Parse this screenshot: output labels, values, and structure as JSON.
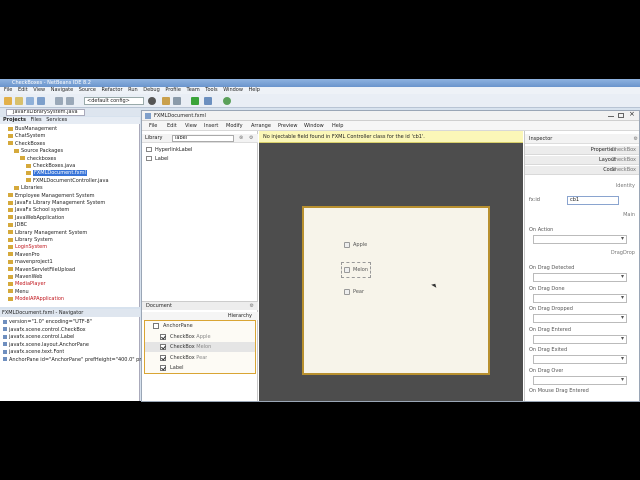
{
  "netbeans": {
    "title": "CheckBoxes - NetBeans IDE 8.2",
    "menu": [
      "File",
      "Edit",
      "View",
      "Navigate",
      "Source",
      "Refactor",
      "Run",
      "Debug",
      "Profile",
      "Team",
      "Tools",
      "Window",
      "Help"
    ],
    "config": "<default config>",
    "file_tab": "JavaFxLibrarySystem.java",
    "project_tabs": [
      "Projects",
      "Files",
      "Services"
    ],
    "projects": [
      {
        "label": "BusManagement",
        "indent": 1
      },
      {
        "label": "ChatSystem",
        "indent": 1
      },
      {
        "label": "CheckBoxes",
        "indent": 1
      },
      {
        "label": "Source Packages",
        "indent": 2
      },
      {
        "label": "checkboxes",
        "indent": 3
      },
      {
        "label": "CheckBoxes.java",
        "indent": 4
      },
      {
        "label": "FXMLDocument.fxml",
        "indent": 4,
        "selected": true
      },
      {
        "label": "FXMLDocumentController.java",
        "indent": 4
      },
      {
        "label": "Libraries",
        "indent": 2
      },
      {
        "label": "Employee Management System",
        "indent": 1
      },
      {
        "label": "JavaFx Library Management System",
        "indent": 1
      },
      {
        "label": "JavaFx School system",
        "indent": 1
      },
      {
        "label": "JavaWebApplication",
        "indent": 1
      },
      {
        "label": "JDBC",
        "indent": 1
      },
      {
        "label": "Library Management System",
        "indent": 1
      },
      {
        "label": "Library System",
        "indent": 1
      },
      {
        "label": "LoginSystem",
        "indent": 1,
        "red": true
      },
      {
        "label": "MavenPro",
        "indent": 1
      },
      {
        "label": "mavenproject1",
        "indent": 1
      },
      {
        "label": "MavenServletFileUpload",
        "indent": 1
      },
      {
        "label": "MavenWeb",
        "indent": 1
      },
      {
        "label": "MediaPlayer",
        "indent": 1,
        "red": true
      },
      {
        "label": "Menu",
        "indent": 1
      },
      {
        "label": "ModelAPApplication",
        "indent": 1,
        "red": true
      }
    ],
    "navigator_title": "FXMLDocument.fxml - Navigator",
    "navigator": [
      "version=\"1.0\" encoding=\"UTF-8\"",
      "javafx.scene.control.CheckBox",
      "javafx.scene.control.Label",
      "javafx.scene.layout.AnchorPane",
      "javafx.scene.text.Font",
      "AnchorPane id=\"AnchorPane\" prefHeight=\"400.0\" prefWidth"
    ]
  },
  "scenebuilder": {
    "title": "FXMLDocument.fxml",
    "menu": [
      "File",
      "Edit",
      "View",
      "Insert",
      "Modify",
      "Arrange",
      "Preview",
      "Window",
      "Help"
    ],
    "library_label": "Library",
    "library_search": "label",
    "library_items": [
      "HyperlinkLabel",
      "Label"
    ],
    "document_label": "Document",
    "hierarchy_label": "Hierarchy",
    "hierarchy": [
      {
        "type": "AnchorPane",
        "value": "",
        "checked": false,
        "root": true
      },
      {
        "type": "CheckBox",
        "value": "Apple",
        "checked": true
      },
      {
        "type": "CheckBox",
        "value": "Melon",
        "checked": true,
        "selected": true
      },
      {
        "type": "CheckBox",
        "value": "Pear",
        "checked": true
      },
      {
        "type": "Label",
        "value": "",
        "checked": true
      }
    ],
    "warning": "No injectable field found in FXML Controller class for the id 'cb1'.",
    "canvas_checkboxes": [
      "Apple",
      "Melon",
      "Pear"
    ],
    "inspector_label": "Inspector",
    "sections": [
      "Properties",
      "Layout",
      "Code"
    ],
    "section_values": {
      "properties": "CheckBox",
      "layout": "CheckBox",
      "code": "CheckBox"
    },
    "identity_label": "Identity",
    "fxid_label": "fx:id",
    "fxid_value": "cb1",
    "main_label": "Main",
    "on_action_label": "On Action",
    "dragdrop_label": "DragDrop",
    "events": [
      "On Drag Detected",
      "On Drag Done",
      "On Drag Dropped",
      "On Drag Entered",
      "On Drag Exited",
      "On Drag Over",
      "On Mouse Drag Entered"
    ]
  }
}
